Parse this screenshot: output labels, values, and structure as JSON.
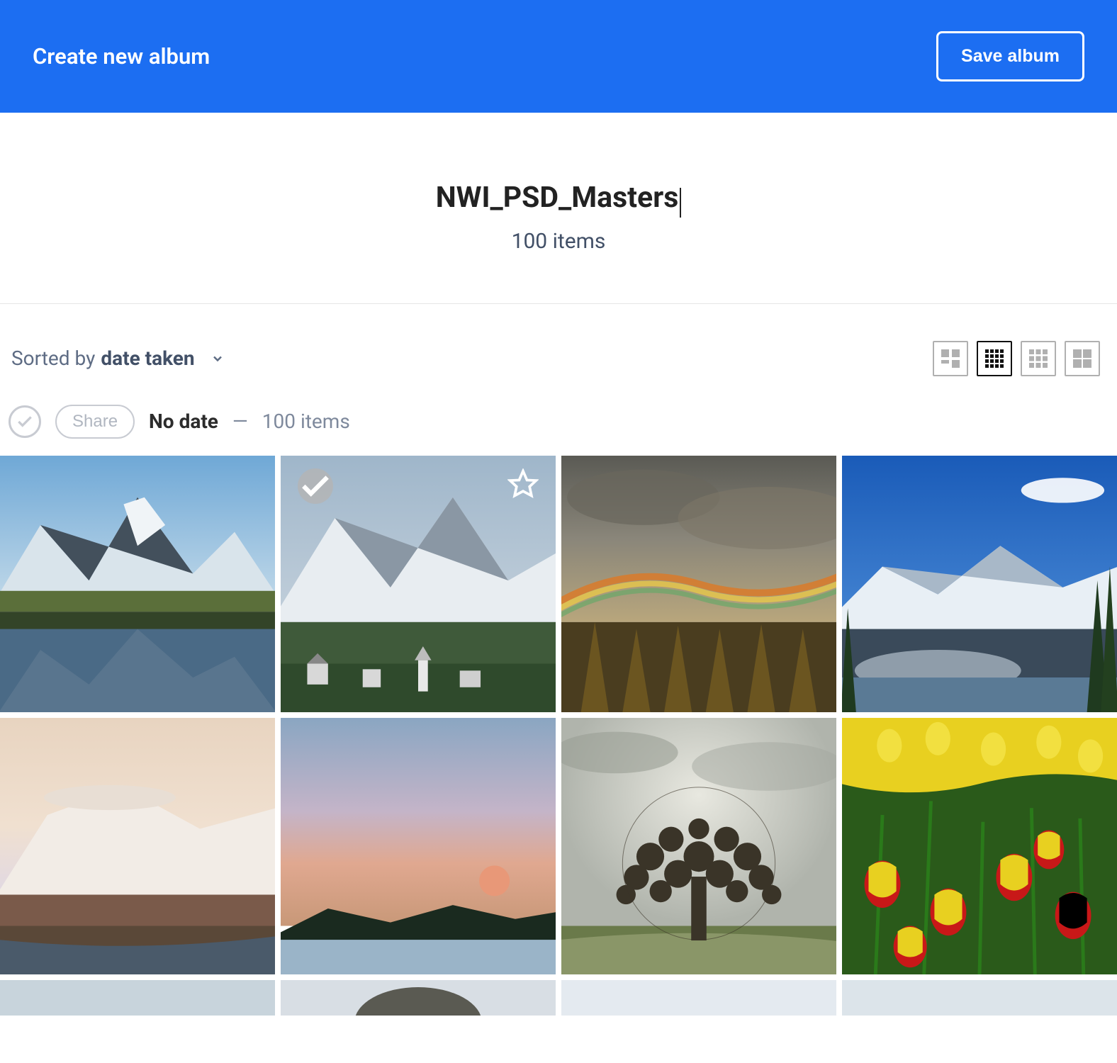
{
  "header": {
    "title": "Create new album",
    "save_label": "Save album"
  },
  "album": {
    "name": "NWI_PSD_Masters",
    "subtitle": "100 items"
  },
  "sort": {
    "prefix": "Sorted by ",
    "value": "date taken"
  },
  "section": {
    "share_label": "Share",
    "label": "No date",
    "separator": "—",
    "count": "100 items"
  }
}
